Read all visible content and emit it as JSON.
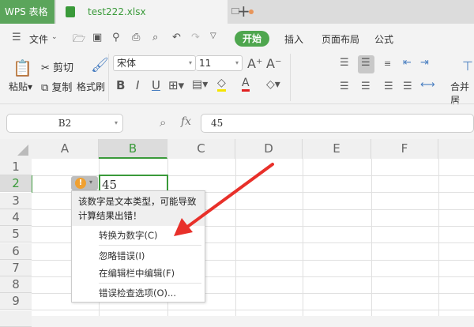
{
  "app": {
    "name": "WPS 表格"
  },
  "file_tab": {
    "name": "test222.xlsx"
  },
  "menu": {
    "file": "文件",
    "tabs": [
      "开始",
      "插入",
      "页面布局",
      "公式"
    ]
  },
  "clipboard": {
    "paste": "粘贴",
    "cut": "剪切",
    "copy": "复制",
    "format_painter": "格式刷"
  },
  "font": {
    "name": "宋体",
    "size": "11"
  },
  "merge": "合并居",
  "formula_bar": {
    "cell_ref": "B2",
    "fx": "fx",
    "value": "45"
  },
  "columns": [
    "A",
    "B",
    "C",
    "D",
    "E",
    "F"
  ],
  "rows": [
    "1",
    "2",
    "3",
    "4",
    "5",
    "6",
    "7",
    "8",
    "9"
  ],
  "cell_b2": "45",
  "error_popup": {
    "message": "该数字是文本类型，可能导致计算结果出错！",
    "items": [
      "转换为数字(C)",
      "忽略错误(I)",
      "在编辑栏中编辑(F)",
      "错误检查选项(O)..."
    ]
  },
  "colors": {
    "accent": "#4ea64e",
    "arrow": "#e8302a",
    "warning": "#f0a030"
  }
}
